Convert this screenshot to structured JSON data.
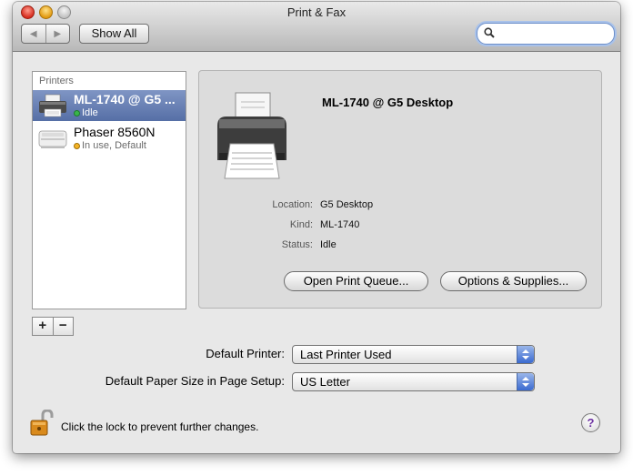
{
  "window": {
    "title": "Print & Fax"
  },
  "toolbar": {
    "back_label": "◀",
    "forward_label": "▶",
    "show_all_label": "Show All",
    "search": {
      "value": "",
      "placeholder": ""
    }
  },
  "printers": {
    "header": "Printers",
    "items": [
      {
        "name": "ML-1740 @ G5 ...",
        "status": "Idle",
        "status_color": "#39b54a",
        "selected": true
      },
      {
        "name": "Phaser 8560N",
        "status": "In use, Default",
        "status_color": "#f4b326",
        "selected": false
      }
    ],
    "add_label": "+",
    "remove_label": "−"
  },
  "detail": {
    "name": "ML-1740 @ G5 Desktop",
    "location_label": "Location:",
    "location_value": "G5 Desktop",
    "kind_label": "Kind:",
    "kind_value": "ML-1740",
    "status_label": "Status:",
    "status_value": "Idle",
    "open_queue_label": "Open Print Queue...",
    "options_label": "Options & Supplies..."
  },
  "settings": {
    "default_printer_label": "Default Printer:",
    "default_printer_value": "Last Printer Used",
    "paper_size_label": "Default Paper Size in Page Setup:",
    "paper_size_value": "US Letter"
  },
  "footer": {
    "lock_text": "Click the lock to prevent further changes.",
    "help_label": "?"
  },
  "colors": {
    "selection": "#566fa6",
    "accent": "#3a6ad0"
  }
}
